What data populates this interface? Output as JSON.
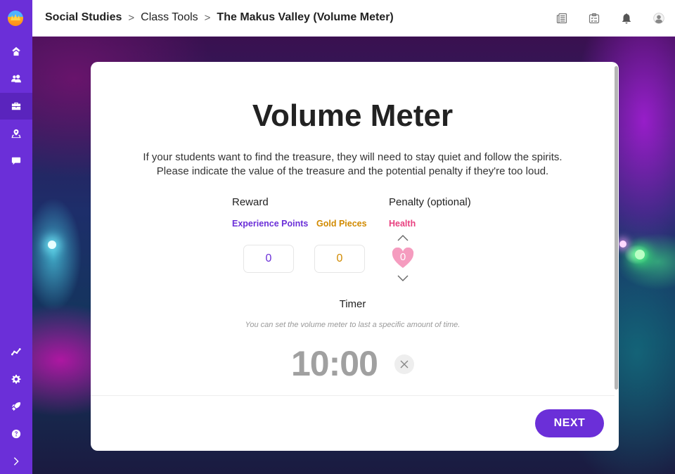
{
  "sidebar": {
    "items": [
      {
        "name": "home",
        "icon": "home-icon"
      },
      {
        "name": "students",
        "icon": "users-icon"
      },
      {
        "name": "class-tools",
        "icon": "briefcase-icon",
        "active": true
      },
      {
        "name": "map",
        "icon": "map-pin-icon"
      },
      {
        "name": "messages",
        "icon": "chat-icon"
      }
    ],
    "bottom_items": [
      {
        "name": "reports",
        "icon": "trend-icon"
      },
      {
        "name": "settings",
        "icon": "gear-icon"
      },
      {
        "name": "tools",
        "icon": "rocket-icon"
      },
      {
        "name": "help",
        "icon": "help-icon"
      },
      {
        "name": "expand",
        "icon": "chevron-right-icon"
      }
    ]
  },
  "header": {
    "breadcrumb": [
      {
        "label": "Social Studies"
      },
      {
        "label": "Class Tools"
      },
      {
        "label": "The Makus Valley (Volume Meter)"
      }
    ],
    "separator": ">",
    "icons": [
      "newspaper-icon",
      "clipboard-icon",
      "bell-icon",
      "user-avatar-icon"
    ]
  },
  "modal": {
    "title": "Volume Meter",
    "description_line1": "If your students want to find the treasure, they will need to stay quiet and follow the spirits.",
    "description_line2": "Please indicate the value of the treasure and the potential penalty if they're too loud.",
    "reward": {
      "label": "Reward",
      "experience_points": {
        "label": "Experience Points",
        "value": "0",
        "color": "#6b2fd8"
      },
      "gold_pieces": {
        "label": "Gold Pieces",
        "value": "0",
        "color": "#d18a00"
      }
    },
    "penalty": {
      "label": "Penalty (optional)",
      "health": {
        "label": "Health",
        "value": "0",
        "color": "#e8407f",
        "heart_color": "#f59cbf"
      }
    },
    "timer": {
      "label": "Timer",
      "hint": "You can set the volume meter to last a specific amount of time.",
      "value": "10:00"
    },
    "next_label": "NEXT"
  },
  "colors": {
    "brand": "#6b2fd8",
    "sidebar_active": "#5a24bd"
  }
}
